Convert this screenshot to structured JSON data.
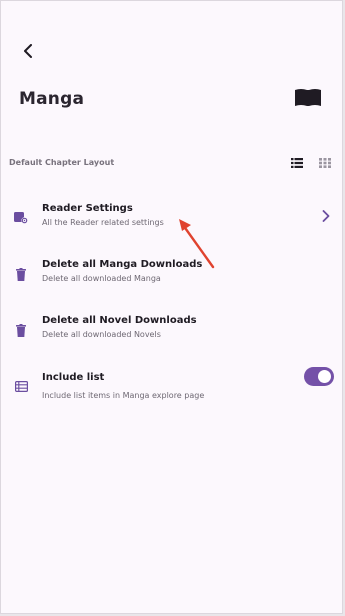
{
  "page": {
    "title": "Manga"
  },
  "layout": {
    "label": "Default Chapter Layout"
  },
  "settings": [
    {
      "title": "Reader Settings",
      "subtitle": "All the Reader related settings"
    },
    {
      "title": "Delete all Manga Downloads",
      "subtitle": "Delete all downloaded Manga"
    },
    {
      "title": "Delete all Novel Downloads",
      "subtitle": "Delete all downloaded Novels"
    },
    {
      "title": "Include list",
      "subtitle": "Include list items in Manga explore page"
    }
  ],
  "include_list_toggle": {
    "on": true
  },
  "icons": {
    "back": "back-arrow-icon",
    "book": "book-open-icon",
    "list_layout": "list-view-icon",
    "grid_layout": "grid-view-icon",
    "reader": "reader-settings-icon",
    "delete_manga": "trash-icon",
    "delete_novel": "trash-icon",
    "include_list": "list-icon",
    "chevron": "chevron-right-icon"
  },
  "colors": {
    "accent": "#7451a8",
    "icon_purple": "#6b4ea0",
    "background": "#fcf8fd",
    "annotation_arrow": "#e0432f"
  }
}
